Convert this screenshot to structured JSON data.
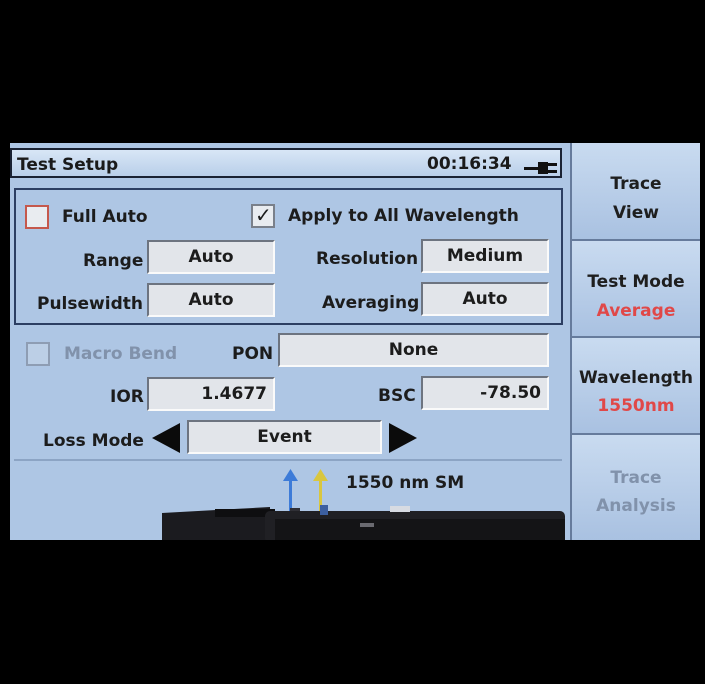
{
  "title": "Test Setup",
  "clock": "00:16:34",
  "icons": {
    "power": "power-plug-icon"
  },
  "full_auto": {
    "label": "Full Auto",
    "checked": false
  },
  "apply_all": {
    "label": "Apply to All Wavelength",
    "checked": true
  },
  "fields": {
    "range": {
      "label": "Range",
      "value": "Auto"
    },
    "resolution": {
      "label": "Resolution",
      "value": "Medium"
    },
    "pulsewidth": {
      "label": "Pulsewidth",
      "value": "Auto"
    },
    "averaging": {
      "label": "Averaging",
      "value": "Auto"
    },
    "pon": {
      "label": "PON",
      "value": "None"
    },
    "ior": {
      "label": "IOR",
      "value": "1.4677"
    },
    "bsc": {
      "label": "BSC",
      "value": "-78.50"
    },
    "loss_mode": {
      "label": "Loss Mode",
      "value": "Event"
    }
  },
  "macro_bend": {
    "label": "Macro Bend",
    "checked": false,
    "enabled": false
  },
  "port_label": "1550 nm SM",
  "side_buttons": [
    {
      "line1": "Trace",
      "line2": "View"
    },
    {
      "line1": "Test Mode",
      "line2": "Average"
    },
    {
      "line1": "Wavelength",
      "line2": "1550nm"
    },
    {
      "line1": "Trace",
      "line2": "Analysis"
    }
  ],
  "colors": {
    "screen_bg": "#aec6e4",
    "accent_red": "#e04848",
    "disabled_text": "#8192ab"
  }
}
